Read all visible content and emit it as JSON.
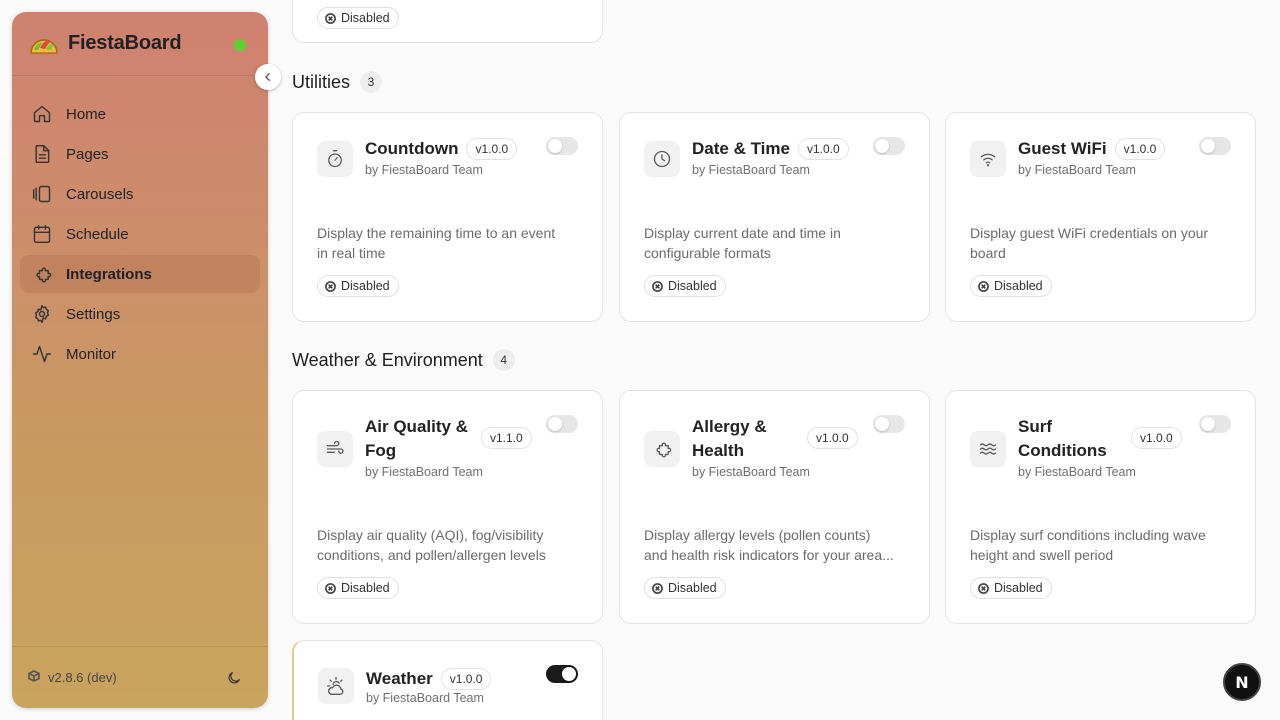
{
  "app": {
    "brand": "FiestaBoard",
    "version": "v2.8.6 (dev)"
  },
  "sidebar": {
    "items": [
      {
        "label": "Home",
        "icon": "home-icon"
      },
      {
        "label": "Pages",
        "icon": "document-icon"
      },
      {
        "label": "Carousels",
        "icon": "carousel-icon"
      },
      {
        "label": "Schedule",
        "icon": "calendar-icon"
      },
      {
        "label": "Integrations",
        "icon": "puzzle-icon",
        "active": true
      },
      {
        "label": "Settings",
        "icon": "gear-icon"
      },
      {
        "label": "Monitor",
        "icon": "activity-icon"
      }
    ]
  },
  "top_card": {
    "status": "Disabled"
  },
  "sections": [
    {
      "title": "Utilities",
      "count": "3",
      "cards": [
        {
          "title": "Countdown",
          "version": "v1.0.0",
          "author": "by FiestaBoard Team",
          "desc_lines": [
            "Display the remaining time to an event",
            "in real time"
          ],
          "status": "Disabled",
          "enabled": false,
          "icon": "timer-icon"
        },
        {
          "title": "Date & Time",
          "version": "v1.0.0",
          "author": "by FiestaBoard Team",
          "desc_lines": [
            "Display current date and time in",
            "configurable formats"
          ],
          "status": "Disabled",
          "enabled": false,
          "icon": "clock-icon"
        },
        {
          "title": "Guest WiFi",
          "version": "v1.0.0",
          "author": "by FiestaBoard Team",
          "desc_lines": [
            "Display guest WiFi credentials on your",
            "board"
          ],
          "status": "Disabled",
          "enabled": false,
          "icon": "wifi-icon"
        }
      ]
    },
    {
      "title": "Weather & Environment",
      "count": "4",
      "cards": [
        {
          "title_lines": [
            "Air Quality &",
            "Fog"
          ],
          "version": "v1.1.0",
          "author": "by FiestaBoard Team",
          "desc_lines": [
            "Display air quality (AQI), fog/visibility",
            "conditions, and pollen/allergen levels"
          ],
          "status": "Disabled",
          "enabled": false,
          "icon": "wind-icon"
        },
        {
          "title_lines": [
            "Allergy &",
            "Health"
          ],
          "version": "v1.0.0",
          "author": "by FiestaBoard Team",
          "desc_lines": [
            "Display allergy levels (pollen counts)",
            "and health risk indicators for your area..."
          ],
          "status": "Disabled",
          "enabled": false,
          "icon": "puzzle-icon"
        },
        {
          "title_lines": [
            "Surf",
            "Conditions"
          ],
          "version": "v1.0.0",
          "author": "by FiestaBoard Team",
          "desc_lines": [
            "Display surf conditions including wave",
            "height and swell period"
          ],
          "status": "Disabled",
          "enabled": false,
          "icon": "waves-icon"
        },
        {
          "title": "Weather",
          "version": "v1.0.0",
          "author": "by FiestaBoard Team",
          "enabled": true,
          "icon": "cloud-sun-icon"
        }
      ]
    }
  ],
  "floating": {
    "label": "N"
  }
}
